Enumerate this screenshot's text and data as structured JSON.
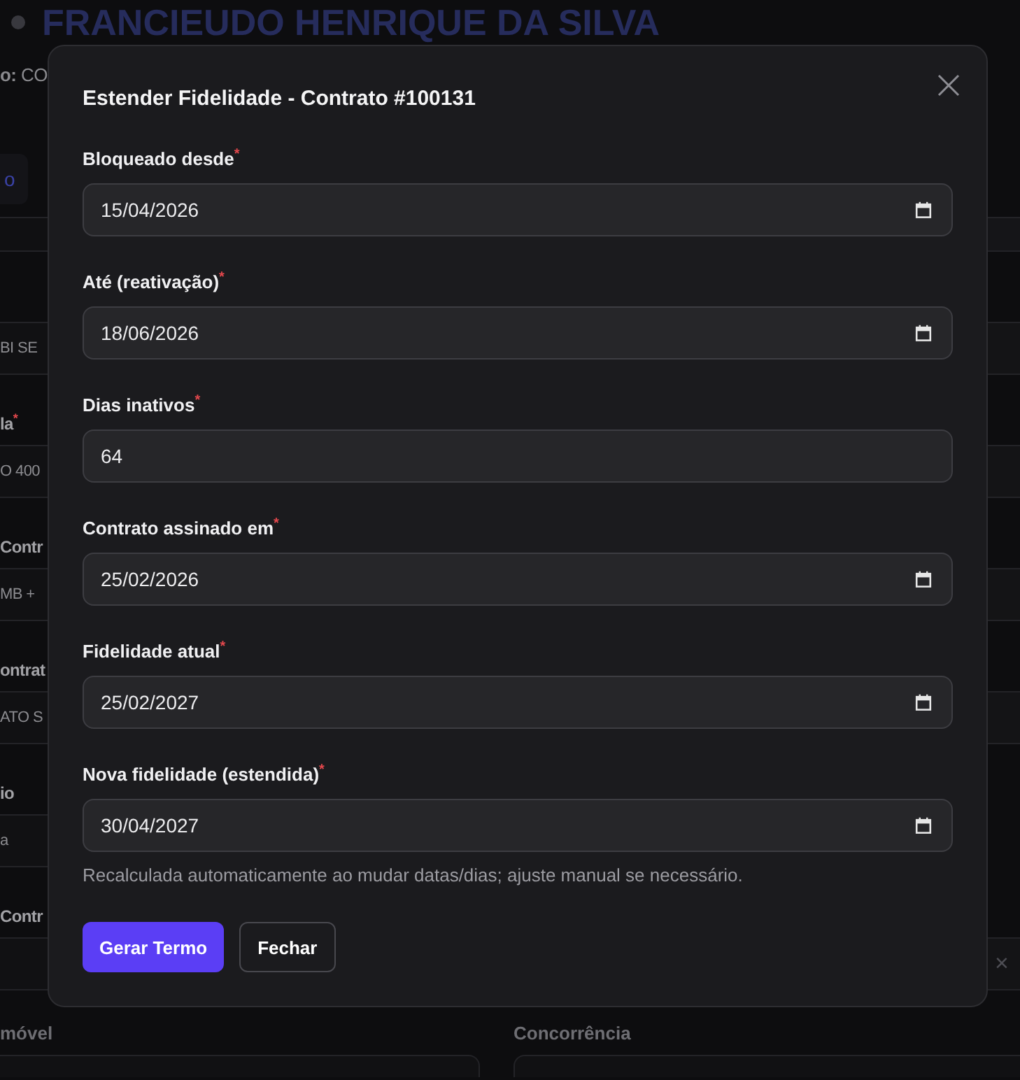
{
  "page": {
    "title": "FRANCIEUDO HENRIQUE DA SILVA",
    "subtitle": "**o:** CO",
    "tab": {
      "label": "o",
      "selected": true
    },
    "side_rows": [
      {
        "value": "BI SE",
        "right_field": true
      },
      {
        "label": "la",
        "required_mark": "*",
        "value": "O 400",
        "right_field": true
      },
      {
        "label": "Contr",
        "value": "MB +",
        "right_field": true
      },
      {
        "label": "ontrat",
        "value": "ATO S",
        "right_field": true
      },
      {
        "label": "io",
        "value": "a",
        "right_field": false
      },
      {
        "label": "Contr",
        "right_field": true,
        "clear_symbol": "×"
      }
    ],
    "bottom_fields": [
      {
        "label": "móvel"
      },
      {
        "label": "Concorrência"
      }
    ]
  },
  "dialog": {
    "title": "Estender Fidelidade - Contrato #100131",
    "fields": [
      {
        "label": "Bloqueado desde",
        "required_mark": "*",
        "kind": "date",
        "value": "15/04/2026"
      },
      {
        "label": "Até (reativação)",
        "required_mark": "*",
        "kind": "date",
        "value": "18/06/2026"
      },
      {
        "label": "Dias inativos",
        "required_mark": "*",
        "kind": "number",
        "value": "64"
      },
      {
        "label": "Contrato assinado em",
        "required_mark": "*",
        "kind": "date",
        "value": "25/02/2026"
      },
      {
        "label": "Fidelidade atual",
        "required_mark": "*",
        "kind": "date",
        "value": "25/02/2027"
      },
      {
        "label": "Nova fidelidade (estendida)",
        "required_mark": "*",
        "kind": "date",
        "value": "30/04/2027"
      }
    ],
    "hint": "Recalculada automaticamente ao mudar datas/dias; ajuste manual se necessário.",
    "buttons": [
      {
        "label": "Gerar Termo",
        "kind": "primary"
      },
      {
        "label": "Fechar",
        "kind": "secondary"
      }
    ]
  }
}
